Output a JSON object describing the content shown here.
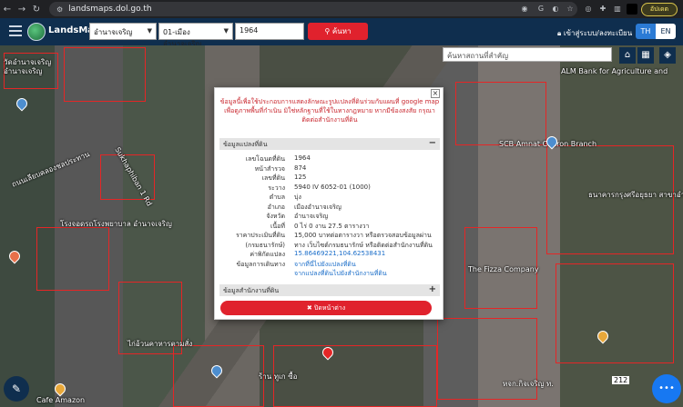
{
  "browser": {
    "url": "landsmaps.dol.go.th",
    "profile_label": "อัปเดต"
  },
  "header": {
    "brand": "LandsMaps",
    "province": "อำนาจเจริญ",
    "district": "01-เมืองอำนาจเจริญ",
    "parcel_no": "1964",
    "search_label": "ค้นหา",
    "login_label": "เข้าสู่ระบบ/ลงทะเบียน",
    "lang_th": "TH",
    "lang_en": "EN"
  },
  "map": {
    "place_search_placeholder": "ค้นหาสถานที่สำคัญ",
    "scale_label": "212",
    "labels": [
      "วัดอำนาจเจริญ",
      "อำนาจเจริญ",
      "ถนนเลียบคลองชลประทาน",
      "Sukhaphiban 1 Rd",
      "SCB Amnat Charon Branch",
      "The Fizza Company",
      "โรงจอดรถโรงพยาบาล อำนาจเจริญ",
      "ไก่อ้วนคาหารตามสั่ง",
      "ร้าน ทูเก ซื้อ",
      "หจก.กิจเจริญ ท.",
      "Cafe Amazon",
      "ALM Bank for Agriculture and",
      "ธนาคารกรุงศรีอยุธยา สาขาอำนาจเจริญ"
    ]
  },
  "modal": {
    "notice": "ข้อมูลนี้เพื่อใช้ประกอบการแสดงลักษณะรูปแปลงที่ดินร่วมกับแผนที่ google map เพื่อดูภาพพื้นที่กำเนิน มิใช่หลักฐานที่ใช้ในทางกฎหมาย หากมีข้องสงสัย กรุณาติดต่อสำนักงานที่ดิน",
    "section1_title": "ข้อมูลแปลงที่ดิน",
    "section1_toggle": "−",
    "rows": [
      {
        "label": "เลขโฉนดที่ดิน",
        "value": "1964"
      },
      {
        "label": "หน้าสำรวจ",
        "value": "874"
      },
      {
        "label": "เลขที่ดิน",
        "value": "125"
      },
      {
        "label": "ระวาง",
        "value": "5940 IV 6052-01 (1000)"
      },
      {
        "label": "ตำบล",
        "value": "บุ่ง"
      },
      {
        "label": "อำเภอ",
        "value": "เมืองอำนาจเจริญ"
      },
      {
        "label": "จังหวัด",
        "value": "อำนาจเจริญ"
      },
      {
        "label": "เนื้อที่",
        "value": "0 ไร่ 0 งาน 27.5 ตารางวา"
      },
      {
        "label": "ราคาประเมินที่ดิน",
        "value": "15,000 บาทต่อตารางวา หรือตรวจสอบข้อมูลผ่าน"
      },
      {
        "label": "(กรมธนารักษ์)",
        "value": "ทาง เว็บไซต์กรมธนารักษ์ หรือติดต่อสำนักงานที่ดิน"
      },
      {
        "label": "ค่าพิกัดแปลง",
        "value": "15.86469221,104.62538431"
      },
      {
        "label": "ข้อมูลการเดินทาง",
        "value": "จากที่นี่ไปยังแปลงที่ดิน"
      },
      {
        "label": "",
        "value": "จากแปลงที่ดินไปยังสำนักงานที่ดิน"
      }
    ],
    "section2_title": "ข้อมูลสำนักงานที่ดิน",
    "section2_toggle": "+",
    "close_page_label": "✖ ปิดหน้าต่าง"
  }
}
